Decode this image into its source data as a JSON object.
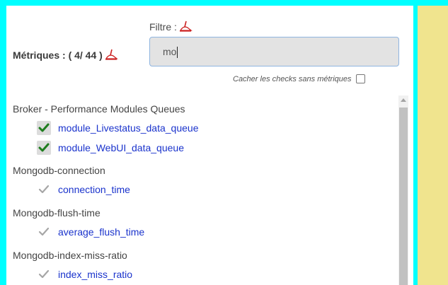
{
  "filter_label": "Filtre :",
  "metrics_label": "Métriques : ( 4/ 44 )",
  "search": {
    "value": "mo"
  },
  "hide_checks_label": "Cacher les checks sans métriques",
  "groups": [
    {
      "title": "Broker - Performance Modules Queues",
      "metrics": [
        {
          "name": "module_Livestatus_data_queue",
          "checked": true
        },
        {
          "name": "module_WebUI_data_queue",
          "checked": true
        }
      ]
    },
    {
      "title": "Mongodb-connection",
      "metrics": [
        {
          "name": "connection_time",
          "checked": false
        }
      ]
    },
    {
      "title": "Mongodb-flush-time",
      "metrics": [
        {
          "name": "average_flush_time",
          "checked": false
        }
      ]
    },
    {
      "title": "Mongodb-index-miss-ratio",
      "metrics": [
        {
          "name": "index_miss_ratio",
          "checked": false
        }
      ]
    }
  ],
  "colors": {
    "frame": "#00ffff",
    "side_panel": "#f0e48e",
    "link": "#1a33cc",
    "check_green": "#1e7d1e",
    "check_gray": "#a6a6a6",
    "broom": "#cc2222"
  }
}
